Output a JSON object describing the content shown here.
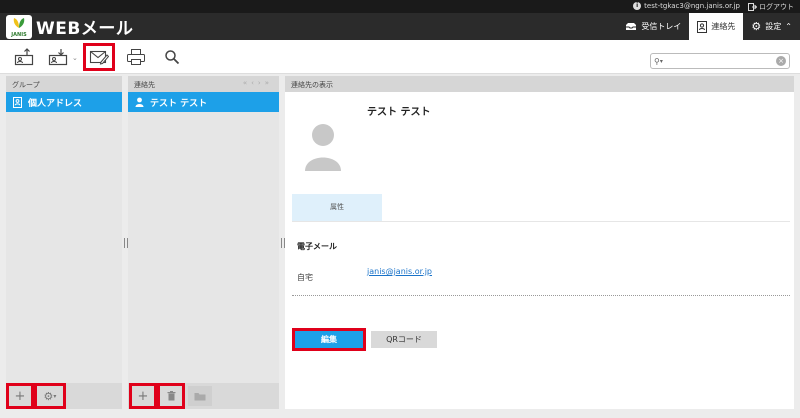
{
  "header": {
    "user_email": "test-tgkac3@ngn.janis.or.jp",
    "logout_label": "ログアウト",
    "logo_text": "WEBメール",
    "logo_badge": "JANIS",
    "nav": [
      {
        "label": "受信トレイ",
        "icon": "inbox-icon"
      },
      {
        "label": "連絡先",
        "icon": "address-book-icon",
        "active": true
      },
      {
        "label": "設定",
        "icon": "gear-icon"
      }
    ]
  },
  "toolbar": {
    "buttons": [
      "import-icon",
      "export-icon",
      "compose-icon",
      "print-icon",
      "search-icon"
    ],
    "search_placeholder": "",
    "highlight_color": "#e0001a"
  },
  "groups": {
    "header": "グループ",
    "items": [
      {
        "label": "個人アドレス",
        "selected": true
      }
    ]
  },
  "contacts": {
    "header": "連絡先",
    "items": [
      {
        "label": "テスト テスト",
        "selected": true
      }
    ]
  },
  "detail": {
    "header": "連絡先の表示",
    "name": "テスト テスト",
    "tab": "属性",
    "section": "電子メール",
    "field_label": "自宅",
    "field_value": "janis@janis.or.jp",
    "edit_label": "編集",
    "qr_label": "QRコード"
  },
  "colors": {
    "accent": "#1da0e8",
    "topbar": "#2b2b2b"
  }
}
